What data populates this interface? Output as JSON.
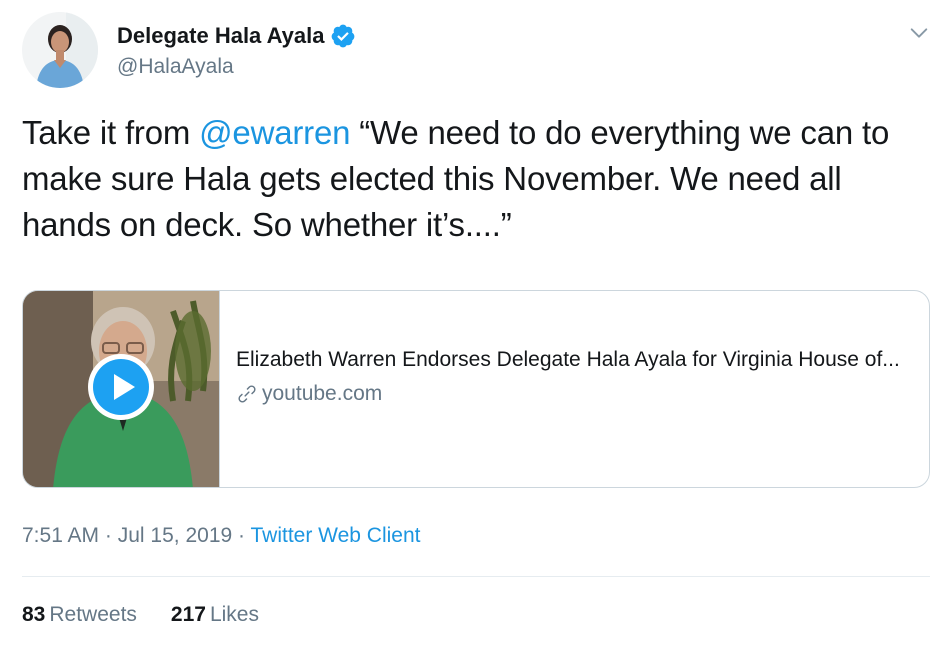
{
  "author": {
    "display_name": "Delegate Hala Ayala",
    "handle": "@HalaAyala",
    "verified": true,
    "avatar_icon": "profile-photo"
  },
  "tweet": {
    "text_before": "Take it from ",
    "mention": "@ewarren",
    "text_after": " “We need to do everything we can to make sure Hala gets elected this November. We need all hands on deck. So whether it’s....”"
  },
  "card": {
    "title": "Elizabeth Warren Endorses Delegate Hala Ayala for Virginia House of...",
    "domain": "youtube.com",
    "thumbnail_icon": "video-thumbnail",
    "play_icon": "play-icon"
  },
  "meta": {
    "time": "7:51 AM",
    "separator": "·",
    "date": "Jul 15, 2019",
    "source": "Twitter Web Client"
  },
  "stats": {
    "retweets_count": "83",
    "retweets_label": "Retweets",
    "likes_count": "217",
    "likes_label": "Likes"
  },
  "colors": {
    "accent": "#1b95e0",
    "text": "#14171a",
    "secondary": "#657786",
    "border": "#ccd6dd"
  }
}
